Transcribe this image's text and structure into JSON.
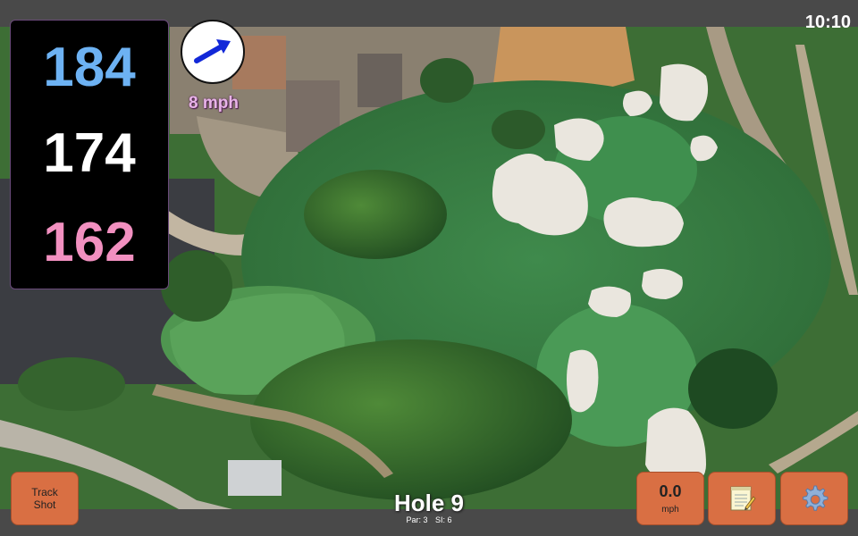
{
  "status_bar": {
    "time": "10:10"
  },
  "distances": {
    "back": "184",
    "center": "174",
    "front": "162"
  },
  "wind": {
    "speed": "8 mph",
    "icon": "wind-arrow-icon"
  },
  "hole": {
    "title": "Hole 9",
    "par": "Par: 3",
    "si": "SI: 6"
  },
  "buttons": {
    "track_shot": {
      "line1": "Track",
      "line2": "Shot"
    },
    "speed": {
      "value": "0.0",
      "unit": "mph"
    },
    "notes": {
      "icon": "notepad-icon"
    },
    "settings": {
      "icon": "gear-icon"
    }
  },
  "colors": {
    "back": "#6db2f3",
    "center": "#ffffff",
    "front": "#f290c0",
    "button": "#d96f43",
    "wind_text": "#e8b3e8"
  }
}
